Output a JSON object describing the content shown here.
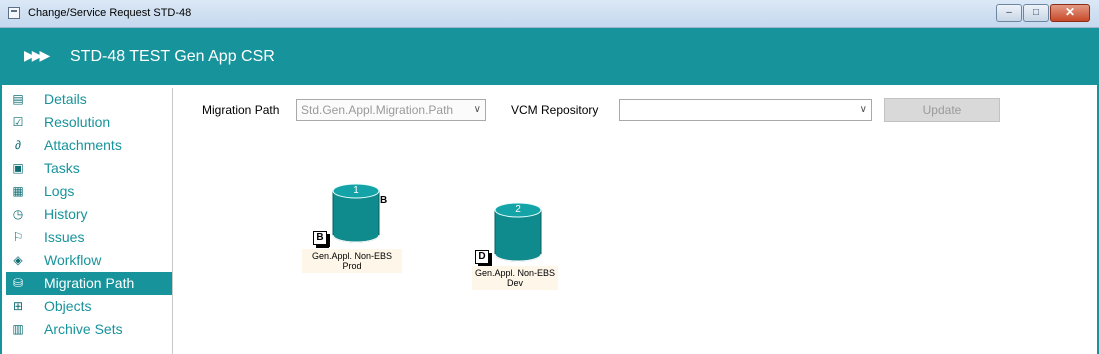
{
  "window": {
    "title": "Change/Service Request STD-48",
    "controls": {
      "minimize": "–",
      "maximize": "□",
      "close": "✕"
    }
  },
  "header": {
    "title": "STD-48  TEST Gen App CSR"
  },
  "sidebar": {
    "items": [
      {
        "label": "Details",
        "icon": "details-icon"
      },
      {
        "label": "Resolution",
        "icon": "resolution-icon"
      },
      {
        "label": "Attachments",
        "icon": "paperclip-icon"
      },
      {
        "label": "Tasks",
        "icon": "tasks-icon"
      },
      {
        "label": "Logs",
        "icon": "logs-icon"
      },
      {
        "label": "History",
        "icon": "clock-icon"
      },
      {
        "label": "Issues",
        "icon": "flag-icon"
      },
      {
        "label": "Workflow",
        "icon": "workflow-icon"
      },
      {
        "label": "Migration Path",
        "icon": "migration-icon",
        "active": true
      },
      {
        "label": "Objects",
        "icon": "objects-icon"
      },
      {
        "label": "Archive Sets",
        "icon": "archive-icon"
      }
    ]
  },
  "form": {
    "migration_path_label": "Migration Path",
    "migration_path_value": "Std.Gen.Appl.Migration.Path",
    "vcm_repository_label": "VCM Repository",
    "vcm_repository_value": "",
    "update_label": "Update"
  },
  "repositories": [
    {
      "number": "1",
      "mark": "B",
      "badge": "B",
      "caption": "Gen.Appl. Non-EBS Prod"
    },
    {
      "number": "2",
      "mark": "",
      "badge": "D",
      "caption": "Gen.Appl. Non-EBS Dev"
    }
  ],
  "colors": {
    "accent": "#17939b",
    "repository": "#0f8b8d"
  }
}
